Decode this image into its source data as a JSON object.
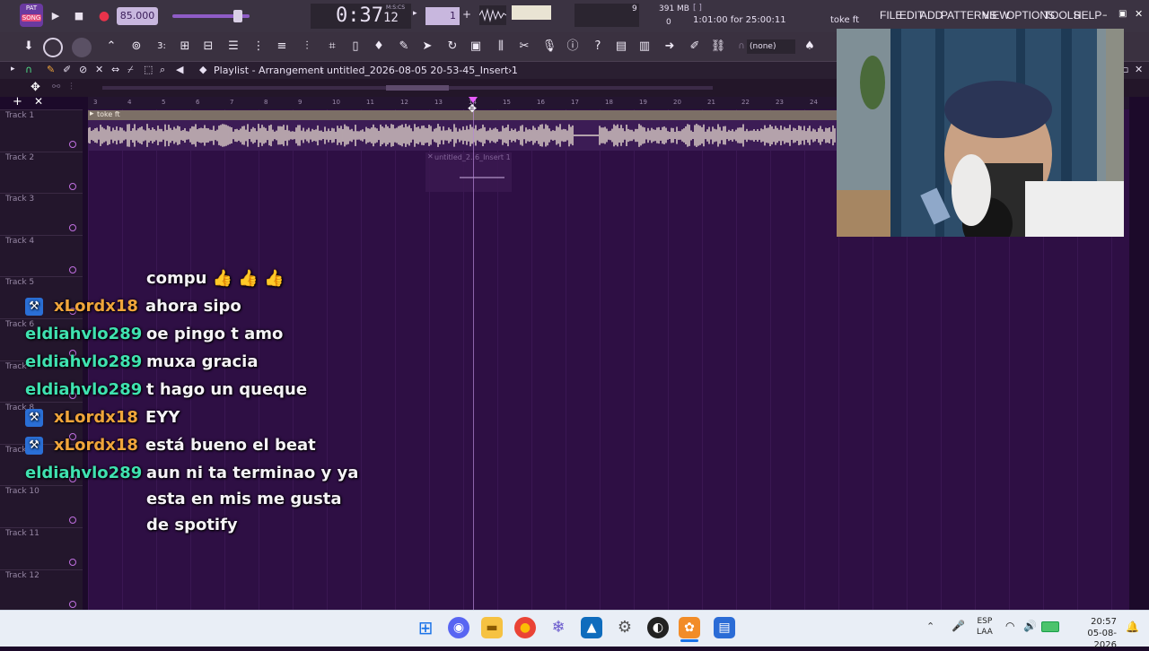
{
  "app": {
    "mode_label_top": "PAT",
    "mode_label_bottom": "SONG",
    "tempo": "85.000",
    "time": "0:37",
    "time_sub": "12",
    "time_unit": "M:S:CS",
    "pattern": "1",
    "cpu_count": "9",
    "memory": "391 MB",
    "poly": "0",
    "hint_bracket": "[ ]",
    "hint_time": "1:01:00 for 25:00:11",
    "project_name": "toke ft",
    "menu": [
      "FILE",
      "EDIT",
      "ADD",
      "PATTERNS",
      "VIEW",
      "OPTIONS",
      "TOOLS",
      "HELP"
    ],
    "none_select": "(none)"
  },
  "playlist": {
    "window_title": "Playlist - Arrangement",
    "path": "untitled_2026-08-05 20-53-45_Insert 1",
    "clip1_label": "toke ft",
    "clip2_label": "untitled_2..6_Insert 1",
    "ruler": [
      "3",
      "4",
      "5",
      "6",
      "7",
      "8",
      "9",
      "10",
      "11",
      "12",
      "13",
      "14",
      "15",
      "16",
      "17",
      "18",
      "19",
      "20",
      "21",
      "22",
      "23",
      "24"
    ],
    "tracks": [
      "Track 1",
      "Track 2",
      "Track 3",
      "Track 4",
      "Track 5",
      "Track 6",
      "Track 7",
      "Track 8",
      "Track 9",
      "Track 10",
      "Track 11",
      "Track 12"
    ]
  },
  "chat": [
    {
      "user": "",
      "message": "compu 👍 👍 👍",
      "badge": false,
      "color": "#ffffff"
    },
    {
      "user": "xLordx18",
      "message": "ahora sipo",
      "badge": true,
      "color": "#f0a53b"
    },
    {
      "user": "eldiahvlo289",
      "message": "oe pingo t amo",
      "badge": false,
      "color": "#3fe2b0"
    },
    {
      "user": "eldiahvlo289",
      "message": "muxa gracia",
      "badge": false,
      "color": "#3fe2b0"
    },
    {
      "user": "eldiahvlo289",
      "message": "t hago un queque",
      "badge": false,
      "color": "#3fe2b0"
    },
    {
      "user": "xLordx18",
      "message": "EYY",
      "badge": true,
      "color": "#f0a53b"
    },
    {
      "user": "xLordx18",
      "message": "está bueno el beat",
      "badge": true,
      "color": "#f0a53b"
    },
    {
      "user": "eldiahvlo289",
      "message": "aun ni ta terminao y ya",
      "badge": false,
      "color": "#3fe2b0"
    },
    {
      "user": "",
      "message": "esta en mis me gusta",
      "badge": false,
      "color": "#ffffff"
    },
    {
      "user": "",
      "message": "de spotify",
      "badge": false,
      "color": "#ffffff"
    }
  ],
  "taskbar": {
    "lang_top": "ESP",
    "lang_bottom": "LAA",
    "clock_time": "20:57",
    "clock_date": "05-08-2026"
  }
}
